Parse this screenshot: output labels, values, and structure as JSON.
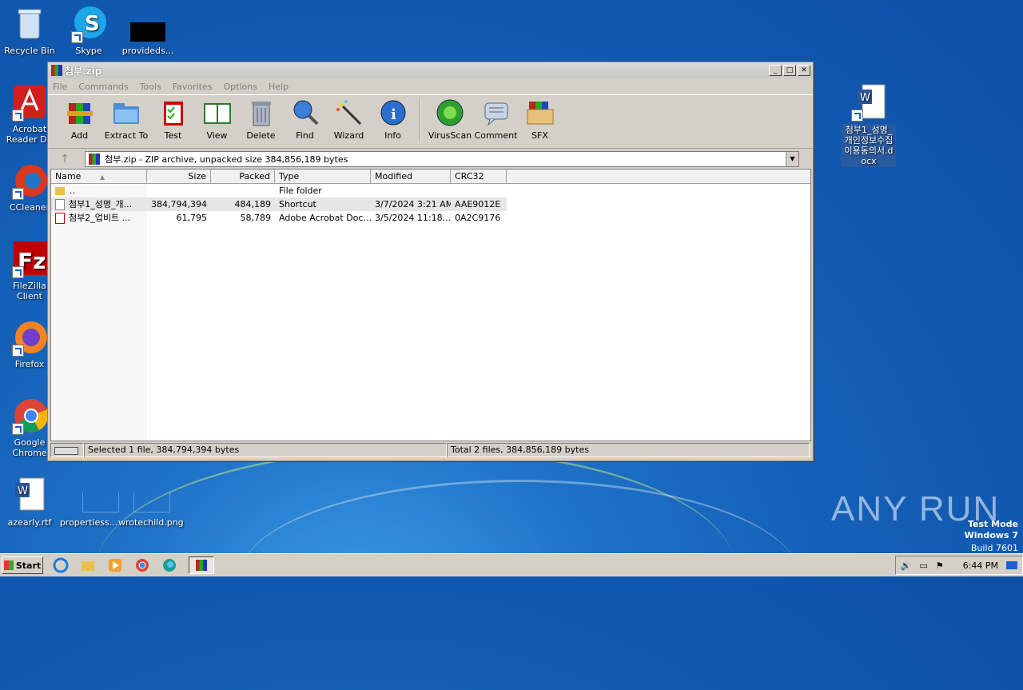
{
  "desktop": {
    "icons": [
      {
        "label": "Recycle Bin"
      },
      {
        "label": "Skype"
      },
      {
        "label": "provideds..."
      },
      {
        "label": "Acrobat Reader DC"
      },
      {
        "label": "CCleaner"
      },
      {
        "label": "FileZilla Client"
      },
      {
        "label": "Firefox"
      },
      {
        "label": "Google Chrome"
      },
      {
        "label": "azearly.rtf"
      },
      {
        "label": "propertiess..."
      },
      {
        "label": "wrotechild.png"
      },
      {
        "label": "첨부1_성명_개인정보수집이용동의서.docx"
      }
    ]
  },
  "window": {
    "title": "첨부.zip",
    "menu": [
      "File",
      "Commands",
      "Tools",
      "Favorites",
      "Options",
      "Help"
    ],
    "toolbar": [
      "Add",
      "Extract To",
      "Test",
      "View",
      "Delete",
      "Find",
      "Wizard",
      "Info",
      "VirusScan",
      "Comment",
      "SFX"
    ],
    "address": "첨부.zip - ZIP archive, unpacked size 384,856,189 bytes",
    "columns": {
      "name": "Name",
      "size": "Size",
      "packed": "Packed",
      "type": "Type",
      "modified": "Modified",
      "crc": "CRC32"
    },
    "rows": [
      {
        "name": "..",
        "size": "",
        "packed": "",
        "type": "File folder",
        "modified": "",
        "crc": ""
      },
      {
        "name": "첨부1_성명_개...",
        "size": "384,794,394",
        "packed": "484,189",
        "type": "Shortcut",
        "modified": "3/7/2024 3:21 AM",
        "crc": "AAE9012E"
      },
      {
        "name": "첨부2_업비트 ...",
        "size": "61,795",
        "packed": "58,789",
        "type": "Adobe Acrobat Doc...",
        "modified": "3/5/2024 11:18...",
        "crc": "0A2C9176"
      }
    ],
    "status_left": "Selected 1 file, 384,794,394 bytes",
    "status_right": "Total 2 files, 384,856,189 bytes"
  },
  "taskbar": {
    "start": "Start",
    "time": "6:44 PM"
  },
  "watermark": {
    "brand": "ANY RUN",
    "line1": "Test Mode",
    "line2": "Windows 7",
    "line3": "Build 7601"
  }
}
